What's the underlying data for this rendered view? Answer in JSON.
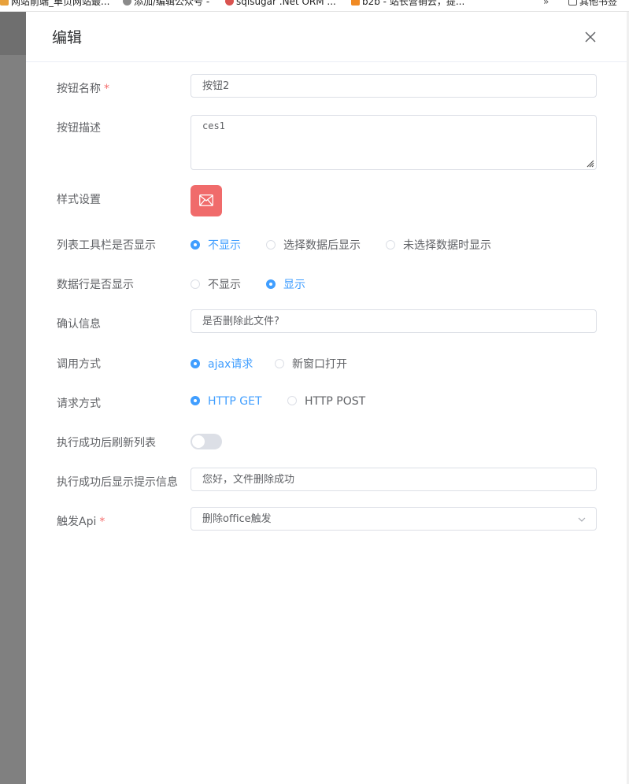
{
  "bookmarks": [
    {
      "label": "网站前端_单页网站最...",
      "color": "#e8a13b"
    },
    {
      "label": "添加/编辑公众号 -",
      "color": "#8a8a8a"
    },
    {
      "label": "sqlsugar .Net ORM ...",
      "color": "#d9534f"
    },
    {
      "label": "b2b - 站长营销云，提...",
      "color": "#f08a24"
    },
    {
      "label": "其他书签",
      "color": "#555555"
    }
  ],
  "drawer": {
    "title": "编辑"
  },
  "form": {
    "button_name": {
      "label": "按钮名称",
      "required_mark": "*",
      "value": "按钮2"
    },
    "button_desc": {
      "label": "按钮描述",
      "value": "ces1"
    },
    "style": {
      "label": "样式设置",
      "icon": "mail-icon",
      "color": "#f06b6b"
    },
    "toolbar_display": {
      "label": "列表工具栏是否显示",
      "options": [
        "不显示",
        "选择数据后显示",
        "未选择数据时显示"
      ],
      "selected": 0
    },
    "row_display": {
      "label": "数据行是否显示",
      "options": [
        "不显示",
        "显示"
      ],
      "selected": 1
    },
    "confirm": {
      "label": "确认信息",
      "value": "是否删除此文件?"
    },
    "call_method": {
      "label": "调用方式",
      "options": [
        "ajax请求",
        "新窗口打开"
      ],
      "selected": 0
    },
    "request_method": {
      "label": "请求方式",
      "options": [
        "HTTP GET",
        "HTTP POST"
      ],
      "selected": 0
    },
    "refresh_after": {
      "label": "执行成功后刷新列表",
      "enabled": false
    },
    "success_msg": {
      "label": "执行成功后显示提示信息",
      "value": "您好，文件删除成功"
    },
    "trigger_api": {
      "label": "触发Api",
      "required_mark": "*",
      "value": "删除office触发"
    }
  },
  "colors": {
    "primary": "#409eff",
    "danger": "#f56c6c",
    "border": "#dcdfe6"
  }
}
